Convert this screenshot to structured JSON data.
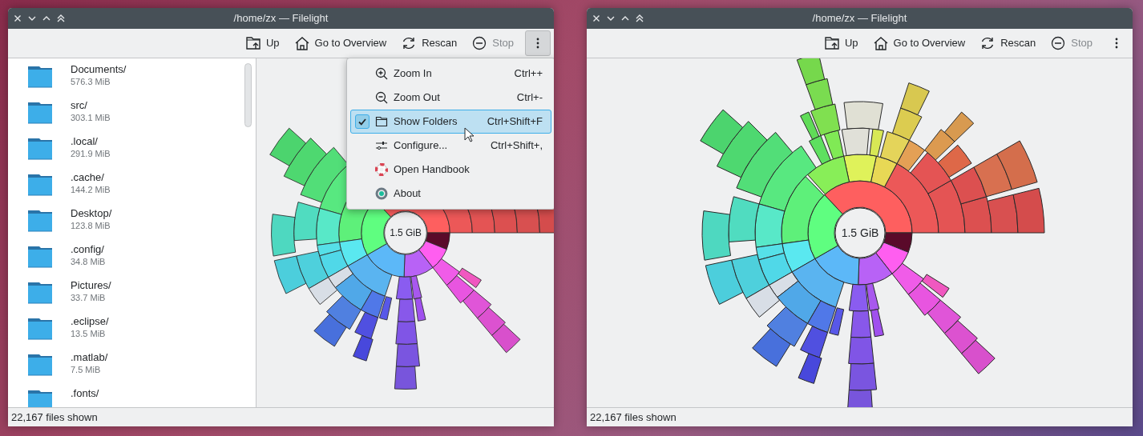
{
  "windows": [
    {
      "title": "/home/zx — Filelight",
      "overflow_open": true,
      "toolbar": [
        {
          "kind": "up",
          "label": "Up",
          "disabled": false
        },
        {
          "kind": "overview",
          "label": "Go to Overview",
          "disabled": false
        },
        {
          "kind": "rescan",
          "label": "Rescan",
          "disabled": false
        },
        {
          "kind": "stop",
          "label": "Stop",
          "disabled": true
        }
      ],
      "sidebar": {
        "items": [
          {
            "name": "Documents/",
            "size": "576.3 MiB"
          },
          {
            "name": "src/",
            "size": "303.1 MiB"
          },
          {
            "name": ".local/",
            "size": "291.9 MiB"
          },
          {
            "name": ".cache/",
            "size": "144.2 MiB"
          },
          {
            "name": "Desktop/",
            "size": "123.8 MiB"
          },
          {
            "name": ".config/",
            "size": "34.8 MiB"
          },
          {
            "name": "Pictures/",
            "size": "33.7 MiB"
          },
          {
            "name": ".eclipse/",
            "size": "13.5 MiB"
          },
          {
            "name": ".matlab/",
            "size": "7.5 MiB"
          },
          {
            "name": ".fonts/"
          }
        ]
      },
      "menu": {
        "items": [
          {
            "kind": "zoom-in",
            "label": "Zoom In",
            "shortcut": "Ctrl++",
            "checked": false,
            "selected": false
          },
          {
            "kind": "zoom-out",
            "label": "Zoom Out",
            "shortcut": "Ctrl+-",
            "checked": false,
            "selected": false
          },
          {
            "kind": "folders",
            "label": "Show Folders",
            "shortcut": "Ctrl+Shift+F",
            "checked": true,
            "selected": true
          },
          {
            "kind": "configure",
            "label": "Configure...",
            "shortcut": "Ctrl+Shift+,",
            "checked": false,
            "selected": false
          },
          {
            "kind": "handbook",
            "label": "Open Handbook",
            "checked": false,
            "selected": false
          },
          {
            "kind": "about",
            "label": "About",
            "checked": false,
            "selected": false
          }
        ]
      },
      "center_label": "1.5 GiB",
      "status": "22,167 files shown"
    },
    {
      "title": "/home/zx — Filelight",
      "overflow_open": false,
      "toolbar": [
        {
          "kind": "up",
          "label": "Up",
          "disabled": false
        },
        {
          "kind": "overview",
          "label": "Go to Overview",
          "disabled": false
        },
        {
          "kind": "rescan",
          "label": "Rescan",
          "disabled": false
        },
        {
          "kind": "stop",
          "label": "Stop",
          "disabled": true
        }
      ],
      "center_label": "1.5 GiB",
      "status": "22,167 files shown"
    }
  ]
}
